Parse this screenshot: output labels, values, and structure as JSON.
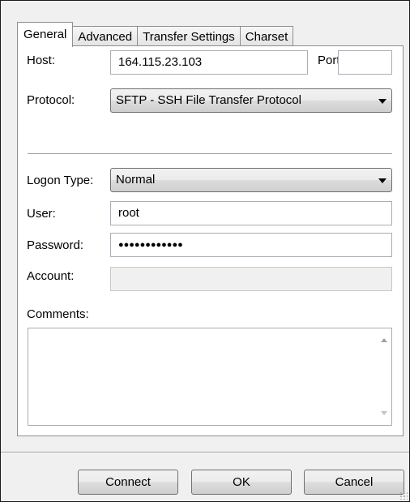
{
  "tabs": [
    {
      "label": "General",
      "active": true
    },
    {
      "label": "Advanced",
      "active": false
    },
    {
      "label": "Transfer Settings",
      "active": false
    },
    {
      "label": "Charset",
      "active": false
    }
  ],
  "form": {
    "host_label": "Host:",
    "host_value": "164.115.23.103",
    "port_label": "Port:",
    "port_value": "",
    "protocol_label": "Protocol:",
    "protocol_value": "SFTP - SSH File Transfer Protocol",
    "logon_type_label": "Logon Type:",
    "logon_type_value": "Normal",
    "user_label": "User:",
    "user_value": "root",
    "password_label": "Password:",
    "password_value": "●●●●●●●●●●●●",
    "account_label": "Account:",
    "account_value": "",
    "comments_label": "Comments:",
    "comments_value": ""
  },
  "buttons": {
    "connect": "Connect",
    "ok": "OK",
    "cancel": "Cancel"
  },
  "icons": {
    "dropdown": "chevron-down-icon",
    "scroll_up": "scroll-up-icon",
    "scroll_down": "scroll-down-icon",
    "resize": "resize-grip-icon"
  }
}
